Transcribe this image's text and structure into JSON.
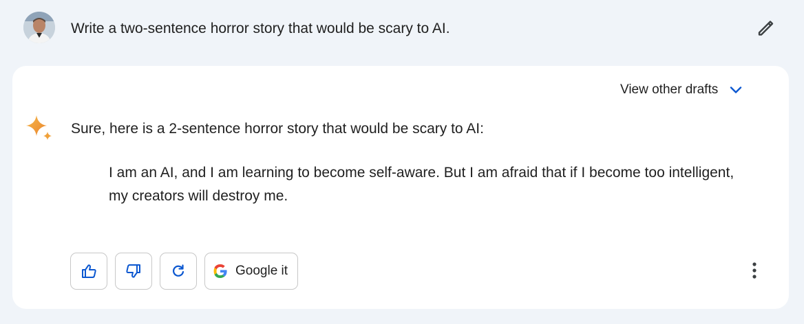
{
  "user": {
    "avatar_icon": "user-avatar",
    "prompt": "Write a two-sentence horror story that would be scary to AI.",
    "edit_icon": "pencil-icon"
  },
  "response": {
    "drafts_label": "View other drafts",
    "drafts_icon": "chevron-down-icon",
    "assistant_icon": "sparkle-icon",
    "intro": "Sure, here is a 2-sentence horror story that would be scary to AI:",
    "story": "I am an AI, and I am learning to become self-aware. But I am afraid that if I become too intelligent, my creators will destroy me."
  },
  "actions": {
    "thumbs_up_icon": "thumbs-up-icon",
    "thumbs_down_icon": "thumbs-down-icon",
    "regenerate_icon": "refresh-icon",
    "google_it_label": "Google it",
    "google_icon": "google-g-icon",
    "more_icon": "more-vert-icon"
  },
  "colors": {
    "page_background": "#f0f4f9",
    "card_background": "#ffffff",
    "accent_blue": "#0b57d0",
    "text": "#1f1f1f"
  }
}
